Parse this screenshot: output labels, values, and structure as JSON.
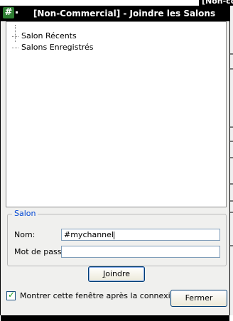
{
  "background_window": {
    "title_fragment": "[Non-co"
  },
  "dialog": {
    "title": "[Non-Commercial] - Joindre les Salons",
    "app_icon_glyph": "#",
    "tree": {
      "items": [
        {
          "label": "Salon Récents"
        },
        {
          "label": "Salons Enregistrés"
        }
      ]
    },
    "salon_group": {
      "legend": "Salon",
      "nom_label": "Nom:",
      "nom_value": "#mychannel",
      "pass_label": "Mot de pass:",
      "pass_value": ""
    },
    "join_button": {
      "label_accel": "J",
      "label_rest": "oindre"
    },
    "show_after_connect": {
      "checked": true,
      "label": "Montrer cette fenêtre après la connexion"
    },
    "close_button": {
      "label": "Fermer"
    },
    "colors": {
      "titlebar": "#000000",
      "legend": "#0046d5",
      "icon_bg": "#2e7d32"
    }
  }
}
